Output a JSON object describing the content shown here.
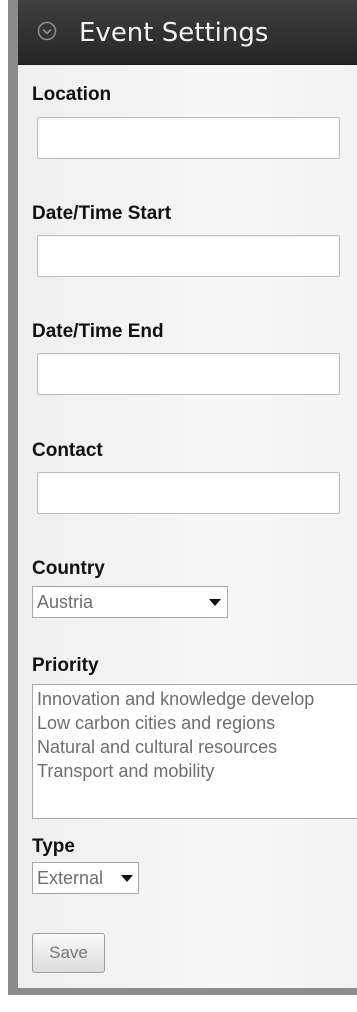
{
  "panel": {
    "title": "Event Settings",
    "header_icon": "chevron-circle-down-icon"
  },
  "fields": {
    "location_label": "Location",
    "location_value": "",
    "date_start_label": "Date/Time Start",
    "date_start_value": "",
    "date_end_label": "Date/Time End",
    "date_end_value": "",
    "contact_label": "Contact",
    "contact_value": ""
  },
  "country": {
    "label": "Country",
    "selected": "Austria"
  },
  "priority": {
    "label": "Priority",
    "options": [
      "Innovation and knowledge develop",
      "Low carbon cities and regions",
      "Natural and cultural resources",
      "Transport and mobility"
    ]
  },
  "type": {
    "label": "Type",
    "selected": "External"
  },
  "actions": {
    "save_label": "Save"
  },
  "colors": {
    "header_bg": "#2f2f2f",
    "panel_bg": "#f4f4f4",
    "frame": "#8c8c8c"
  }
}
